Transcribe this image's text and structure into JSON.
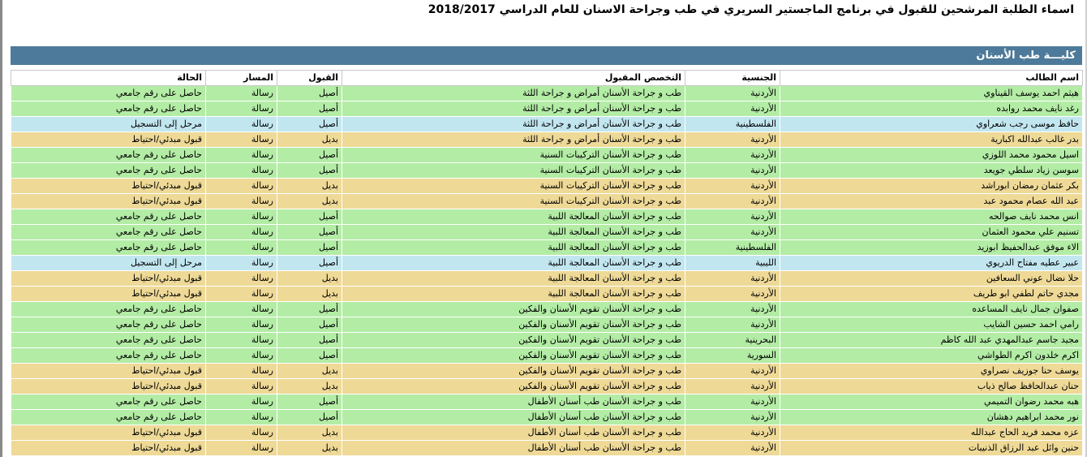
{
  "page": {
    "title": "اسماء الطلبة المرشحين للقبول في برنامج الماجستير السريري في طب وجراحة الاسنان للعام الدراسي 2018/2017"
  },
  "faculty": {
    "name": "كليـــة طب الأسنان"
  },
  "colors": {
    "header_bar": "#4d7a9a",
    "green": "#b3eca5",
    "blue": "#c2e6f0",
    "yellow": "#eed997"
  },
  "table": {
    "columns": [
      "اسم الطالب",
      "الجنسية",
      "التخصص المقبول",
      "القبول",
      "المسار",
      "الحالة"
    ],
    "rows": [
      {
        "name": "هيثم احمد يوسف القيناوي",
        "nat": "الأردنية",
        "spec": "طب و جراحة الأسنان أمراض و جراحة اللثة",
        "adm": "أصيل",
        "track": "رسالة",
        "status": "حاصل على رقم جامعي",
        "style": "green"
      },
      {
        "name": "رغد نايف محمد روابده",
        "nat": "الأردنية",
        "spec": "طب و جراحة الأسنان أمراض و جراحة اللثة",
        "adm": "أصيل",
        "track": "رسالة",
        "status": "حاصل على رقم جامعي",
        "style": "green"
      },
      {
        "name": "حافظ موسى رجب شعراوي",
        "nat": "الفلسطينية",
        "spec": "طب و جراحة الأسنان أمراض و جراحة اللثة",
        "adm": "أصيل",
        "track": "رسالة",
        "status": "مرحل إلى التسجيل",
        "style": "blue"
      },
      {
        "name": "بدر غالب عبدالله اكبارية",
        "nat": "الأردنية",
        "spec": "طب و جراحة الأسنان أمراض و جراحة اللثة",
        "adm": "بديل",
        "track": "رسالة",
        "status": "قبول مبدئي/احتياط",
        "style": "yellow"
      },
      {
        "name": "اسيل محمود محمد اللوزي",
        "nat": "الأردنية",
        "spec": "طب و جراحة الأسنان التركيبات السنية",
        "adm": "أصيل",
        "track": "رسالة",
        "status": "حاصل على رقم جامعي",
        "style": "green"
      },
      {
        "name": "سوسن زياد سلطي جويعد",
        "nat": "الأردنية",
        "spec": "طب و جراحة الأسنان التركيبات السنية",
        "adm": "أصيل",
        "track": "رسالة",
        "status": "حاصل على رقم جامعي",
        "style": "green"
      },
      {
        "name": "بكر عثمان رمضان ابوراشد",
        "nat": "الأردنية",
        "spec": "طب و جراحة الأسنان التركيبات السنية",
        "adm": "بديل",
        "track": "رسالة",
        "status": "قبول مبدئي/احتياط",
        "style": "yellow"
      },
      {
        "name": "عبد الله عصام محمود عبد",
        "nat": "الأردنية",
        "spec": "طب و جراحة الأسنان التركيبات السنية",
        "adm": "بديل",
        "track": "رسالة",
        "status": "قبول مبدئي/احتياط",
        "style": "yellow"
      },
      {
        "name": "انس محمد نايف صوالحه",
        "nat": "الأردنية",
        "spec": "طب و جراحة الأسنان المعالجة اللبية",
        "adm": "أصيل",
        "track": "رسالة",
        "status": "حاصل على رقم جامعي",
        "style": "green"
      },
      {
        "name": "تسنيم علي محمود العثمان",
        "nat": "الأردنية",
        "spec": "طب و جراحة الأسنان المعالجة اللبية",
        "adm": "أصيل",
        "track": "رسالة",
        "status": "حاصل على رقم جامعي",
        "style": "green"
      },
      {
        "name": "الاء موفق عبدالحفيظ ابوزيد",
        "nat": "الفلسطينية",
        "spec": "طب و جراحة الأسنان المعالجة اللبية",
        "adm": "أصيل",
        "track": "رسالة",
        "status": "حاصل على رقم جامعي",
        "style": "green"
      },
      {
        "name": "عبير عطيه مفتاح الدريوي",
        "nat": "الليبية",
        "spec": "طب و جراحة الأسنان المعالجة اللبية",
        "adm": "أصيل",
        "track": "رسالة",
        "status": "مرحل إلى التسجيل",
        "style": "blue"
      },
      {
        "name": "حلا نضال عوني السعافين",
        "nat": "الأردنية",
        "spec": "طب و جراحة الأسنان المعالجة اللبية",
        "adm": "بديل",
        "track": "رسالة",
        "status": "قبول مبدئي/احتياط",
        "style": "yellow"
      },
      {
        "name": "مجدي حاتم لطفي ابو طريف",
        "nat": "الأردنية",
        "spec": "طب و جراحة الأسنان المعالجة اللبية",
        "adm": "بديل",
        "track": "رسالة",
        "status": "قبول مبدئي/احتياط",
        "style": "yellow"
      },
      {
        "name": "صفوان جمال نايف المساعده",
        "nat": "الأردنية",
        "spec": "طب و جراحة الأسنان تقويم الأسنان والفكين",
        "adm": "أصيل",
        "track": "رسالة",
        "status": "حاصل على رقم جامعي",
        "style": "green"
      },
      {
        "name": "رامي احمد حسين الشايب",
        "nat": "الأردنية",
        "spec": "طب و جراحة الأسنان تقويم الأسنان والفكين",
        "adm": "أصيل",
        "track": "رسالة",
        "status": "حاصل على رقم جامعي",
        "style": "green"
      },
      {
        "name": "مجيد جاسم عبدالمهدي عبد الله كاظم",
        "nat": "البحرينية",
        "spec": "طب و جراحة الأسنان تقويم الأسنان والفكين",
        "adm": "أصيل",
        "track": "رسالة",
        "status": "حاصل على رقم جامعي",
        "style": "green"
      },
      {
        "name": "اكرم خلدون اكرم الطواشي",
        "nat": "السورية",
        "spec": "طب و جراحة الأسنان تقويم الأسنان والفكين",
        "adm": "أصيل",
        "track": "رسالة",
        "status": "حاصل على رقم جامعي",
        "style": "green"
      },
      {
        "name": "يوسف حنا جوزيف نصراوي",
        "nat": "الأردنية",
        "spec": "طب و جراحة الأسنان تقويم الأسنان والفكين",
        "adm": "بديل",
        "track": "رسالة",
        "status": "قبول مبدئي/احتياط",
        "style": "yellow"
      },
      {
        "name": "حنان عبدالحافظ صالح ذياب",
        "nat": "الأردنية",
        "spec": "طب و جراحة الأسنان تقويم الأسنان والفكين",
        "adm": "بديل",
        "track": "رسالة",
        "status": "قبول مبدئي/احتياط",
        "style": "yellow"
      },
      {
        "name": "هبه محمد رضوان التميمي",
        "nat": "الأردنية",
        "spec": "طب و جراحة الأسنان طب أسنان الأطفال",
        "adm": "أصيل",
        "track": "رسالة",
        "status": "حاصل على رقم جامعي",
        "style": "green"
      },
      {
        "name": "نور محمد ابراهيم دهشان",
        "nat": "الأردنية",
        "spec": "طب و جراحة الأسنان طب أسنان الأطفال",
        "adm": "أصيل",
        "track": "رسالة",
        "status": "حاصل على رقم جامعي",
        "style": "green"
      },
      {
        "name": "عزه محمد فريد الحاج عبدالله",
        "nat": "الأردنية",
        "spec": "طب و جراحة الأسنان طب أسنان الأطفال",
        "adm": "بديل",
        "track": "رسالة",
        "status": "قبول مبدئي/احتياط",
        "style": "yellow"
      },
      {
        "name": "حنين وائل عبد الرزاق الذنيبات",
        "nat": "الأردنية",
        "spec": "طب و جراحة الأسنان طب أسنان الأطفال",
        "adm": "بديل",
        "track": "رسالة",
        "status": "قبول مبدئي/احتياط",
        "style": "yellow"
      }
    ]
  }
}
